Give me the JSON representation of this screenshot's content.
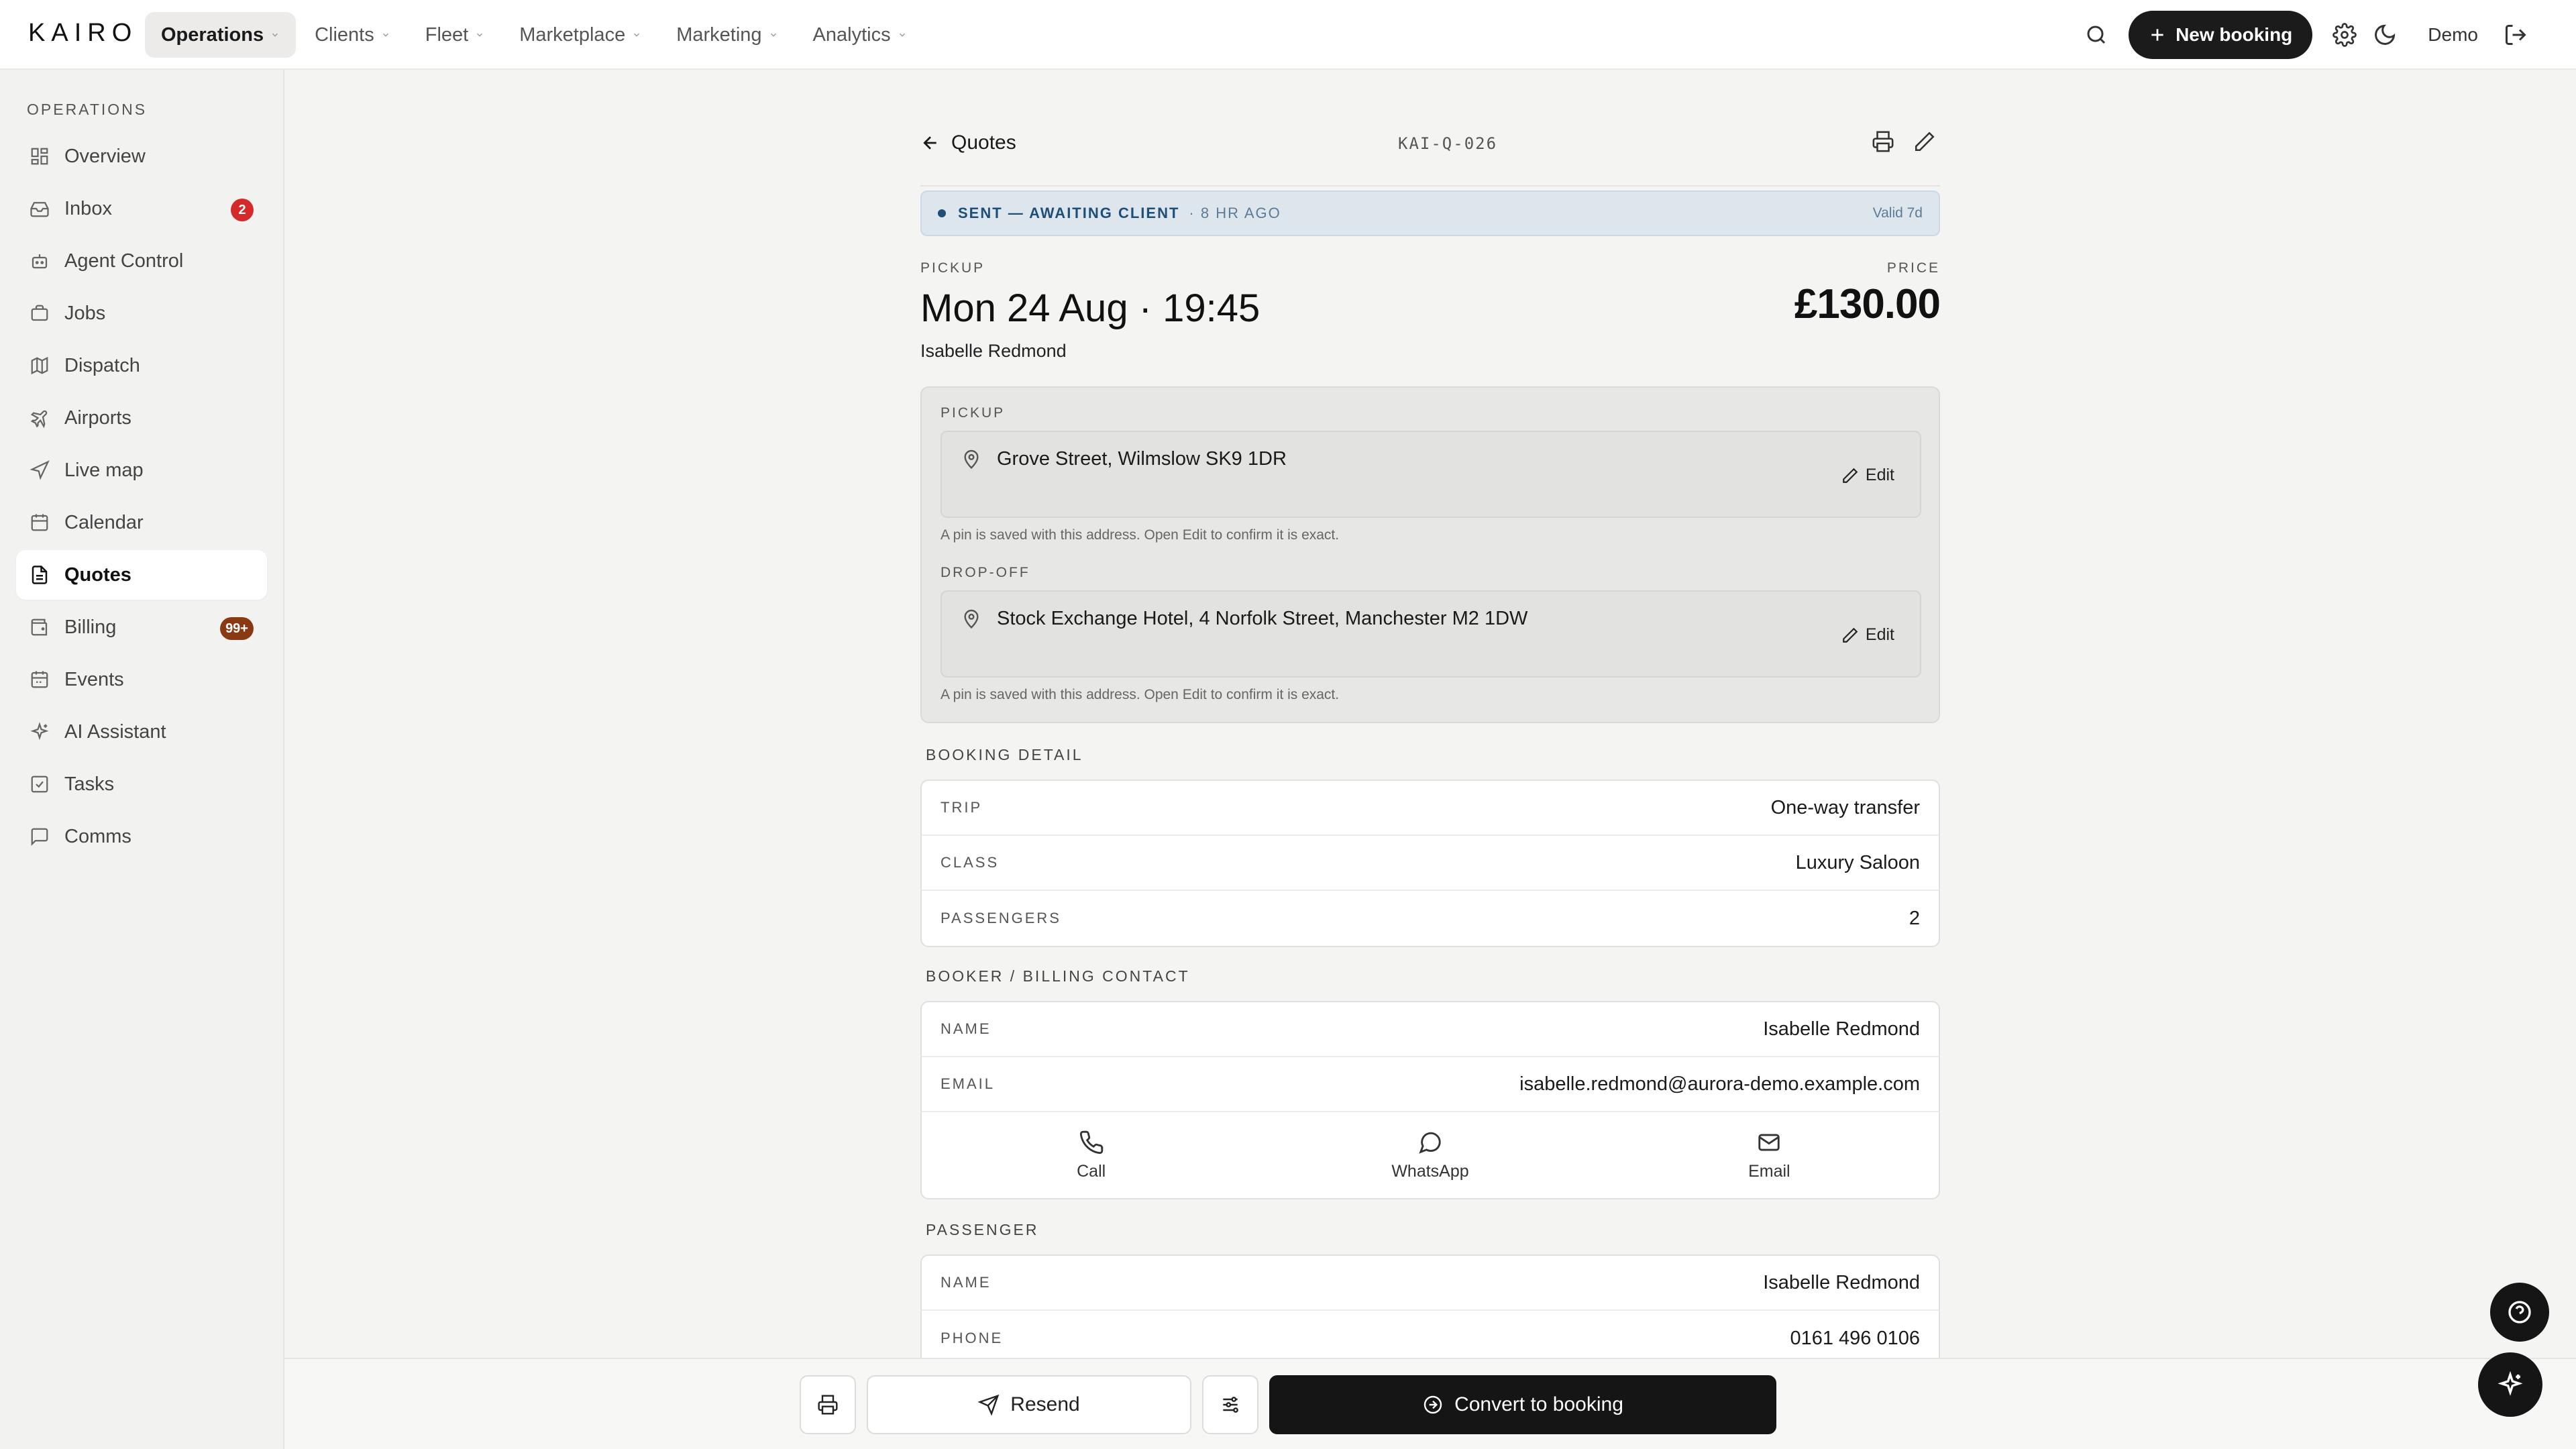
{
  "brand": {
    "logo": "KAIRO"
  },
  "topnav": {
    "items": [
      {
        "label": "Operations",
        "active": true
      },
      {
        "label": "Clients"
      },
      {
        "label": "Fleet"
      },
      {
        "label": "Marketplace"
      },
      {
        "label": "Marketing"
      },
      {
        "label": "Analytics"
      }
    ],
    "new_booking_label": "New booking",
    "user_label": "Demo"
  },
  "sidebar": {
    "heading": "OPERATIONS",
    "items": [
      {
        "label": "Overview",
        "icon": "grid-icon"
      },
      {
        "label": "Inbox",
        "icon": "inbox-icon",
        "badge": "2",
        "badge_color": "#d42a2a"
      },
      {
        "label": "Agent Control",
        "icon": "robot-icon"
      },
      {
        "label": "Jobs",
        "icon": "briefcase-icon"
      },
      {
        "label": "Dispatch",
        "icon": "map-folded-icon"
      },
      {
        "label": "Airports",
        "icon": "plane-icon"
      },
      {
        "label": "Live map",
        "icon": "navigation-icon"
      },
      {
        "label": "Calendar",
        "icon": "calendar-icon"
      },
      {
        "label": "Quotes",
        "icon": "document-icon",
        "active": true
      },
      {
        "label": "Billing",
        "icon": "wallet-icon",
        "badge": "99+",
        "badge_color": "#8a3a12"
      },
      {
        "label": "Events",
        "icon": "calendar-event-icon"
      },
      {
        "label": "AI Assistant",
        "icon": "sparkle-icon"
      },
      {
        "label": "Tasks",
        "icon": "checkbox-icon"
      },
      {
        "label": "Comms",
        "icon": "chat-icon"
      }
    ]
  },
  "quote": {
    "back_label": "Quotes",
    "reference": "KAI-Q-026",
    "status": "SENT — AWAITING CLIENT",
    "status_age": "· 8 HR AGO",
    "valid": "Valid 7d",
    "pickup_label": "PICKUP",
    "pickup_datetime": "Mon 24 Aug · 19:45",
    "client_name": "Isabelle Redmond",
    "price_label": "PRICE",
    "price": "£130.00"
  },
  "addresses": {
    "pickup_label": "PICKUP",
    "pickup": "Grove Street, Wilmslow SK9 1DR",
    "dropoff_label": "DROP-OFF",
    "dropoff": "Stock Exchange Hotel, 4 Norfolk Street, Manchester M2 1DW",
    "edit_label": "Edit",
    "hint": "A pin is saved with this address. Open Edit to confirm it is exact."
  },
  "booking_detail": {
    "title": "BOOKING DETAIL",
    "rows": [
      {
        "key": "TRIP",
        "value": "One-way transfer"
      },
      {
        "key": "CLASS",
        "value": "Luxury Saloon"
      },
      {
        "key": "PASSENGERS",
        "value": "2"
      }
    ]
  },
  "booker": {
    "title": "BOOKER / BILLING CONTACT",
    "rows": [
      {
        "key": "NAME",
        "value": "Isabelle Redmond"
      },
      {
        "key": "EMAIL",
        "value": "isabelle.redmond@aurora-demo.example.com"
      }
    ],
    "actions": {
      "call": "Call",
      "whatsapp": "WhatsApp",
      "email": "Email"
    }
  },
  "passenger": {
    "title": "PASSENGER",
    "rows": [
      {
        "key": "NAME",
        "value": "Isabelle Redmond"
      },
      {
        "key": "PHONE",
        "value": "0161 496 0106"
      }
    ]
  },
  "bottom_bar": {
    "resend_label": "Resend",
    "convert_label": "Convert to booking"
  }
}
